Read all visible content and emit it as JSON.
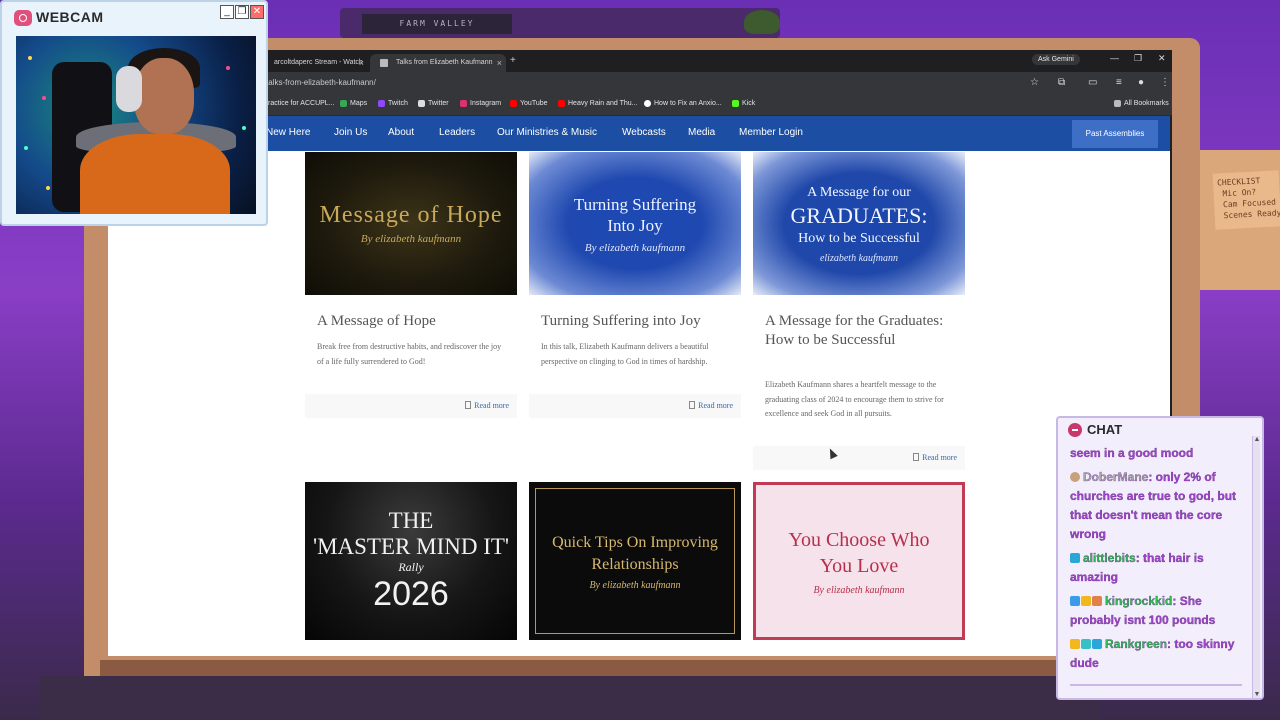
{
  "room": {
    "sign_text": "FARM VALLEY",
    "checklist_note": "CHECKLIST\n Mic On?\n Cam Focused\n Scenes Ready"
  },
  "browser": {
    "tabs": [
      {
        "label": "arcoltdaperc Stream - Watch",
        "close": "×"
      },
      {
        "label": "Talks from Elizabeth Kaufmann",
        "close": "×"
      }
    ],
    "new_tab": "+",
    "ask_gemini": "Ask Gemini",
    "window_controls": {
      "minimize": "—",
      "restore": "❐",
      "close": "✕"
    },
    "url": "talks-from-elizabeth-kaufmann/",
    "bookmarks": [
      {
        "label": "ractice for ACCUPL...",
        "color": "#e8a23a"
      },
      {
        "label": "Maps",
        "color": "#34a853"
      },
      {
        "label": "Twitch",
        "color": "#9146ff"
      },
      {
        "label": "Twitter",
        "color": "#dddddd"
      },
      {
        "label": "Instagram",
        "color": "#e1306c"
      },
      {
        "label": "YouTube",
        "color": "#ff0000"
      },
      {
        "label": "Heavy Rain and Thu...",
        "color": "#ff0000"
      },
      {
        "label": "How to Fix an Anxio...",
        "color": "#ffffff"
      },
      {
        "label": "Kick",
        "color": "#53fc18"
      }
    ],
    "all_bookmarks": "All Bookmarks"
  },
  "site": {
    "nav": [
      "New Here",
      "Join Us",
      "About",
      "Leaders",
      "Our Ministries & Music",
      "Webcasts",
      "Media",
      "Member Login"
    ],
    "nav_cta": "Past Assemblies",
    "cards": [
      {
        "img": {
          "big": "Message of Hope",
          "by": "By elizabeth kaufmann"
        },
        "title": "A Message of Hope",
        "desc": "Break free from destructive habits, and rediscover the joy of a life fully surrendered to God!",
        "read_more": "Read more"
      },
      {
        "img": {
          "big": "Turning Suffering Into Joy",
          "by": "By elizabeth kaufmann"
        },
        "title": "Turning Suffering into Joy",
        "desc": "In this talk, Elizabeth Kaufmann delivers a beautiful perspective on clinging to God in times of hardship.",
        "read_more": "Read more"
      },
      {
        "img": {
          "line1": "A Message for our",
          "line2": "GRADUATES:",
          "line3": "How to be Successful",
          "by": "elizabeth kaufmann"
        },
        "title": "A Message for the Graduates: How to be Successful",
        "desc": "Elizabeth Kaufmann shares a heartfelt message to the graduating class of 2024 to encourage them to strive for excellence and seek God in all pursuits.",
        "read_more": "Read more"
      },
      {
        "img": {
          "line1": "THE",
          "line2": "'MASTER MIND IT'",
          "sub": "Rally",
          "year": "2026"
        }
      },
      {
        "img": {
          "big": "Quick Tips On Improving Relationships",
          "by": "By elizabeth kaufmann"
        }
      },
      {
        "img": {
          "big": "You Choose Who You Love",
          "by": "By elizabeth kaufmann"
        }
      }
    ]
  },
  "webcam": {
    "title": "WEBCAM",
    "buttons": {
      "min": "_",
      "max": "❐",
      "close": "✕"
    }
  },
  "chat": {
    "title": "CHAT",
    "messages": [
      {
        "name": "",
        "text": "seem in a good mood",
        "badges": []
      },
      {
        "name": "DoberMane",
        "text": ": only 2% of churches are true to god, but that doesn't mean the core wrong",
        "badges": [
          "#c7a17a"
        ]
      },
      {
        "name": "alittlebits",
        "text": ": that hair is amazing",
        "badges": [
          "#2aa6d9"
        ]
      },
      {
        "name": "kingrockkid",
        "text": ": She probably isnt 100 pounds",
        "badges": [
          "#3b9be8",
          "#f2b71d",
          "#e0804a"
        ]
      },
      {
        "name": "Rankgreen",
        "text": ": too skinny dude",
        "badges": [
          "#f2b71d",
          "#38c0c8",
          "#2aa6d9"
        ]
      }
    ],
    "name_colors": [
      "#a047c9",
      "#a8a8a8",
      "#2ebd4e",
      "#2ebd4e",
      "#2ebd4e"
    ]
  }
}
